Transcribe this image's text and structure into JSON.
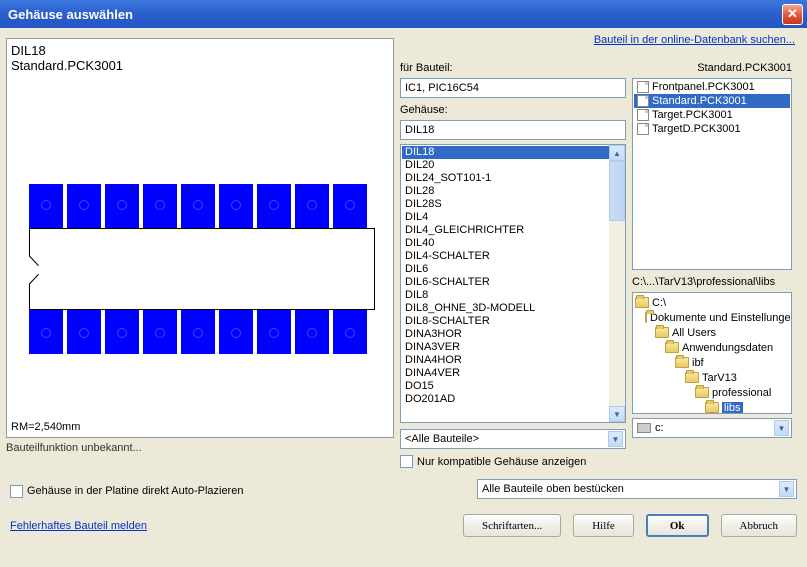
{
  "title": "Gehäuse auswählen",
  "top_link": "Bauteil in der online-Datenbank suchen...",
  "preview": {
    "name": "DIL18",
    "lib": "Standard.PCK3001",
    "rm": "RM=2,540mm",
    "func": "Bauteilfunktion unbekannt..."
  },
  "mid": {
    "part_label": "für Bauteil:",
    "part_value": "IC1, PIC16C54",
    "pkg_label": "Gehäuse:",
    "pkg_value": "DIL18",
    "list": [
      "DIL18",
      "DIL20",
      "DIL24_SOT101-1",
      "DIL28",
      "DIL28S",
      "DIL4",
      "DIL4_GLEICHRICHTER",
      "DIL40",
      "DIL4-SCHALTER",
      "DIL6",
      "DIL6-SCHALTER",
      "DIL8",
      "DIL8_OHNE_3D-MODELL",
      "DIL8-SCHALTER",
      "DINA3HOR",
      "DINA3VER",
      "DINA4HOR",
      "DINA4VER",
      "DO15",
      "DO201AD"
    ],
    "selected": 0,
    "filter": "<Alle Bauteile>",
    "compat": "Nur kompatible Gehäuse anzeigen"
  },
  "right": {
    "current": "Standard.PCK3001",
    "files": [
      "Frontpanel.PCK3001",
      "Standard.PCK3001",
      "Target.PCK3001",
      "TargetD.PCK3001"
    ],
    "file_selected": 1,
    "path": "C:\\...\\TarV13\\professional\\libs",
    "tree": [
      {
        "label": "C:\\",
        "indent": 0,
        "open": true
      },
      {
        "label": "Dokumente und Einstellungen",
        "indent": 1,
        "open": true
      },
      {
        "label": "All Users",
        "indent": 2,
        "open": true
      },
      {
        "label": "Anwendungsdaten",
        "indent": 3,
        "open": true
      },
      {
        "label": "ibf",
        "indent": 4,
        "open": true
      },
      {
        "label": "TarV13",
        "indent": 5,
        "open": true
      },
      {
        "label": "professional",
        "indent": 6,
        "open": true
      },
      {
        "label": "libs",
        "indent": 7,
        "open": true,
        "selected": true
      }
    ],
    "drive": "c:"
  },
  "bottom": {
    "autoplace": "Gehäuse in der Platine direkt Auto-Plazieren",
    "placement": "Alle Bauteile oben bestücken",
    "report": "Fehlerhaftes Bauteil melden",
    "fonts": "Schriftarten...",
    "help": "Hilfe",
    "ok": "Ok",
    "cancel": "Abbruch"
  }
}
